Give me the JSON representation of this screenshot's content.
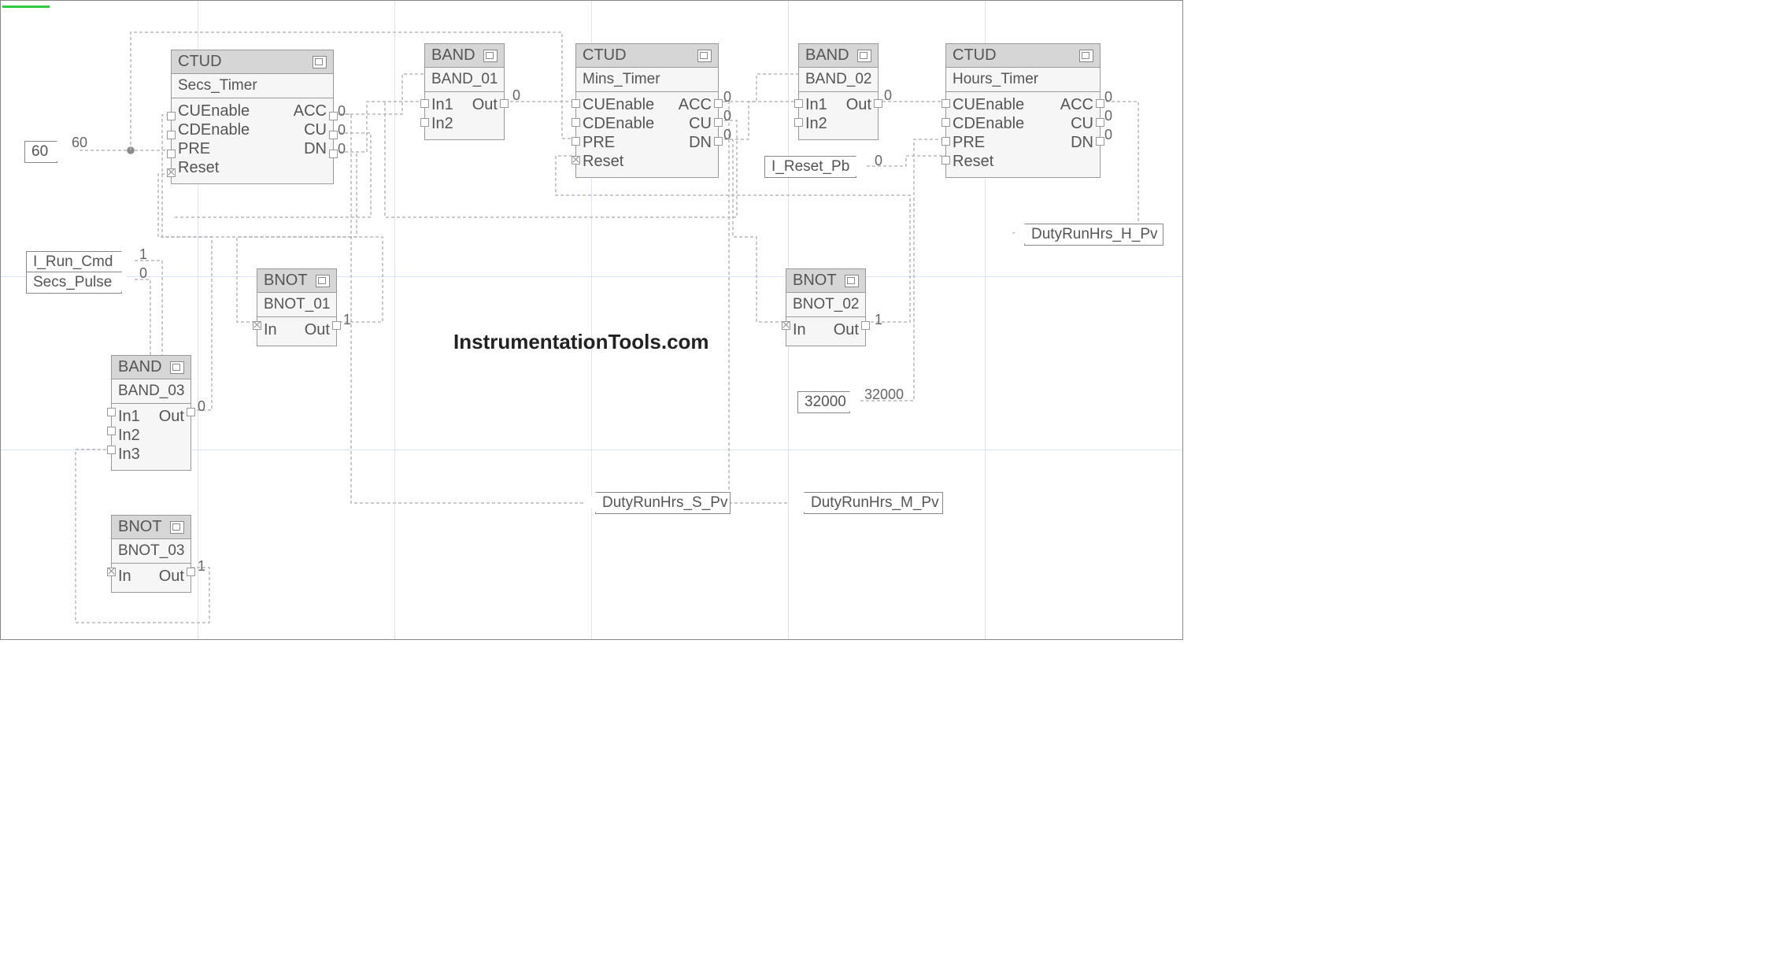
{
  "canvas": {
    "watermark": "InstrumentationTools.com"
  },
  "tags": {
    "const60": "60",
    "run_cmd": "I_Run_Cmd",
    "secs_pulse": "Secs_Pulse",
    "reset_pb": "I_Reset_Pb",
    "const32000": "32000",
    "duty_s": "DutyRunHrs_S_Pv",
    "duty_m": "DutyRunHrs_M_Pv",
    "duty_h": "DutyRunHrs_H_Pv"
  },
  "wirevals": {
    "const60": "60",
    "secs_acc": "0",
    "secs_cu": "0",
    "secs_dn": "0",
    "band01_out": "0",
    "mins_acc": "0",
    "mins_cu": "0",
    "mins_dn": "0",
    "band02_out": "0",
    "hours_acc": "0",
    "hours_cu": "0",
    "hours_dn": "0",
    "reset_pb": "0",
    "run_cmd": "1",
    "secs_pulse": "0",
    "bnot01_out": "1",
    "bnot02_out": "1",
    "band03_out": "0",
    "bnot03_out": "1",
    "const32000": "32000"
  },
  "blockLabels": {
    "ctud": {
      "type": "CTUD",
      "cuenable": "CUEnable",
      "cdenable": "CDEnable",
      "pre": "PRE",
      "reset": "Reset",
      "acc": "ACC",
      "cu": "CU",
      "dn": "DN"
    },
    "band": {
      "type": "BAND",
      "in1": "In1",
      "in2": "In2",
      "in3": "In3",
      "out": "Out"
    },
    "bnot": {
      "type": "BNOT",
      "in": "In",
      "out": "Out"
    }
  },
  "blocks": {
    "secs_timer": {
      "instance": "Secs_Timer"
    },
    "mins_timer": {
      "instance": "Mins_Timer"
    },
    "hours_timer": {
      "instance": "Hours_Timer"
    },
    "band01": {
      "instance": "BAND_01"
    },
    "band02": {
      "instance": "BAND_02"
    },
    "band03": {
      "instance": "BAND_03"
    },
    "bnot01": {
      "instance": "BNOT_01"
    },
    "bnot02": {
      "instance": "BNOT_02"
    },
    "bnot03": {
      "instance": "BNOT_03"
    }
  }
}
